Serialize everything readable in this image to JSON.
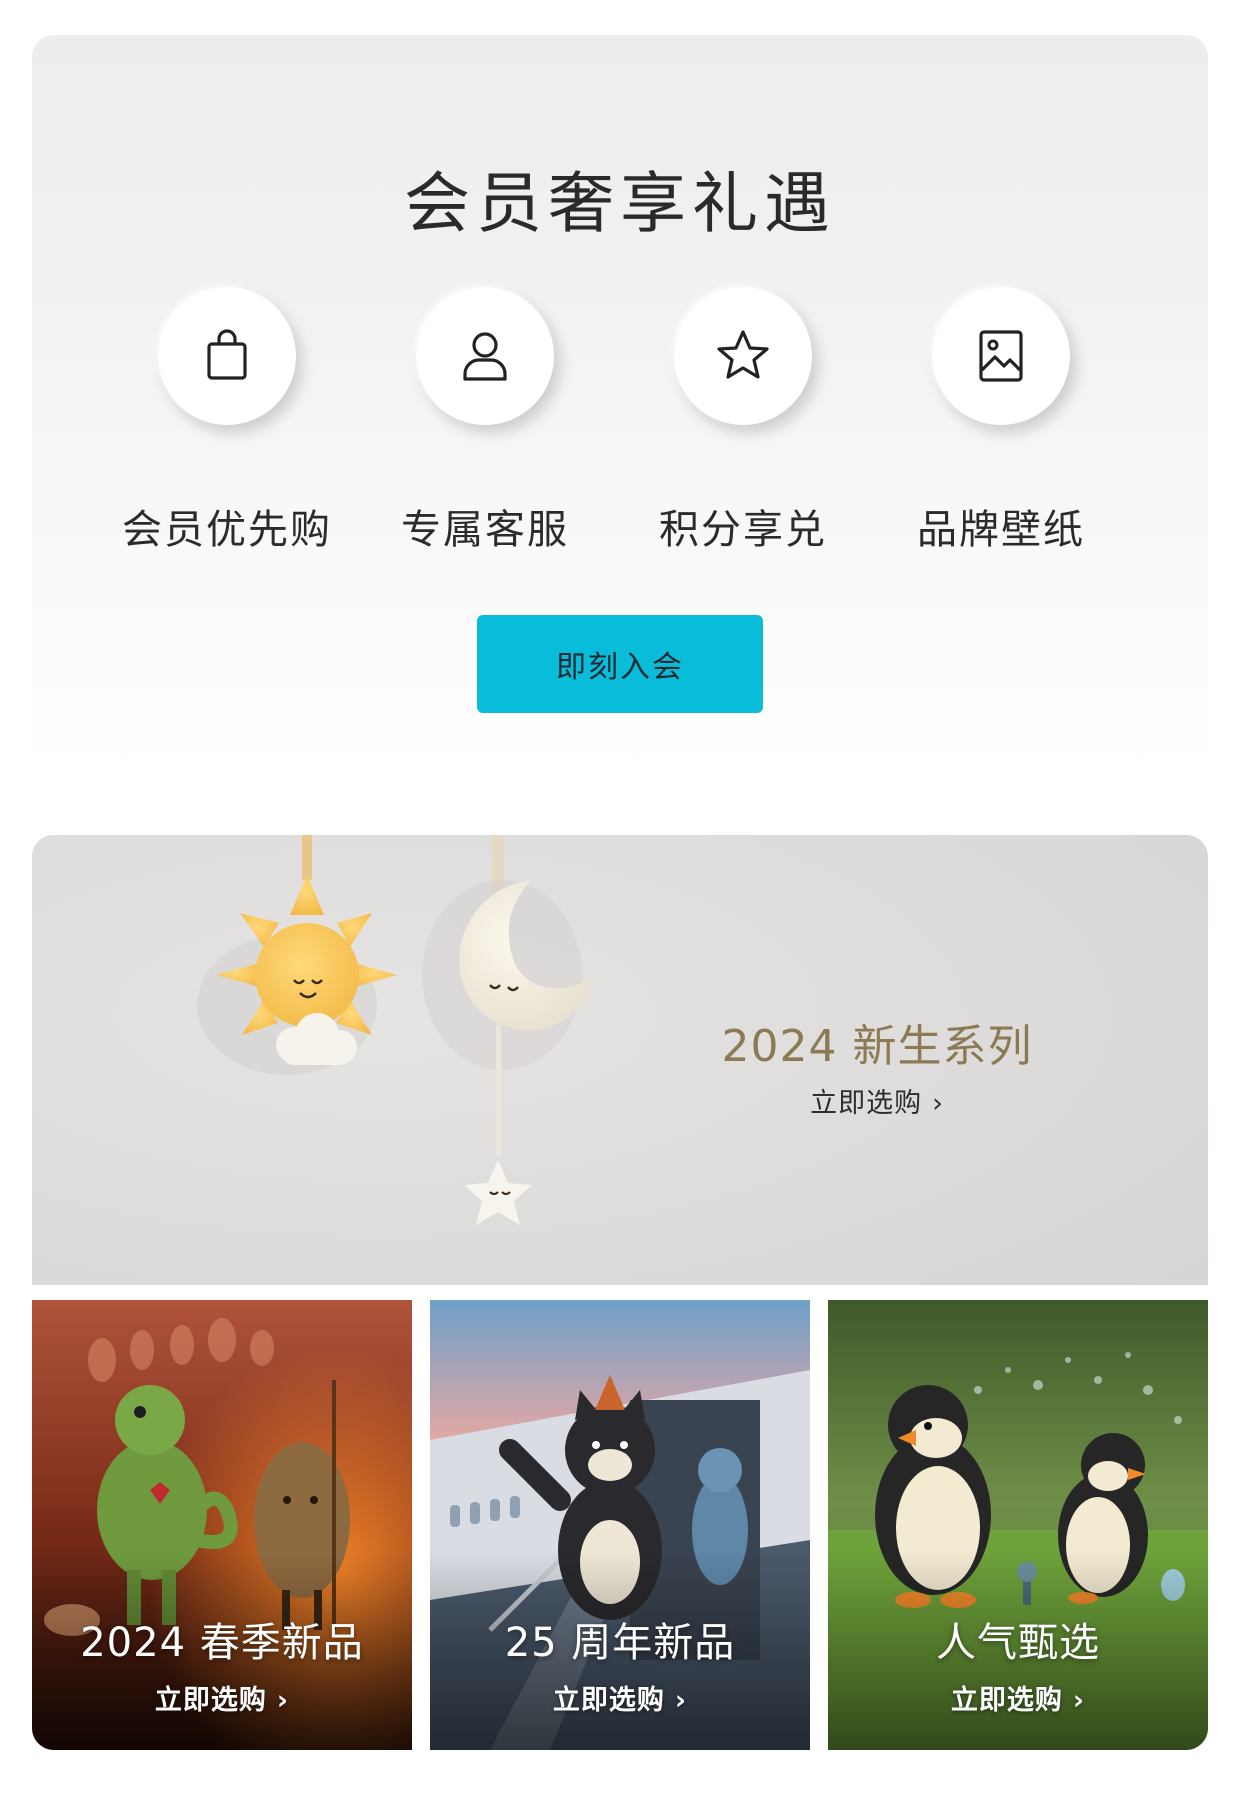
{
  "member": {
    "title": "会员奢享礼遇",
    "benefits": [
      {
        "label": "会员优先购",
        "icon": "shopping-bag-icon"
      },
      {
        "label": "专属客服",
        "icon": "user-icon"
      },
      {
        "label": "积分享兑",
        "icon": "star-icon"
      },
      {
        "label": "品牌壁纸",
        "icon": "image-icon"
      }
    ],
    "join_label": "即刻入会",
    "accent_color": "#09bcd9"
  },
  "hero": {
    "title": "2024 新生系列",
    "link_label": "立即选购",
    "chevron": "›",
    "title_color": "#8c7a55"
  },
  "collections": [
    {
      "title": "2024 春季新品",
      "link_label": "立即选购",
      "chevron": "›"
    },
    {
      "title": "25 周年新品",
      "link_label": "立即选购",
      "chevron": "›"
    },
    {
      "title": "人气甄选",
      "link_label": "立即选购",
      "chevron": "›"
    }
  ]
}
